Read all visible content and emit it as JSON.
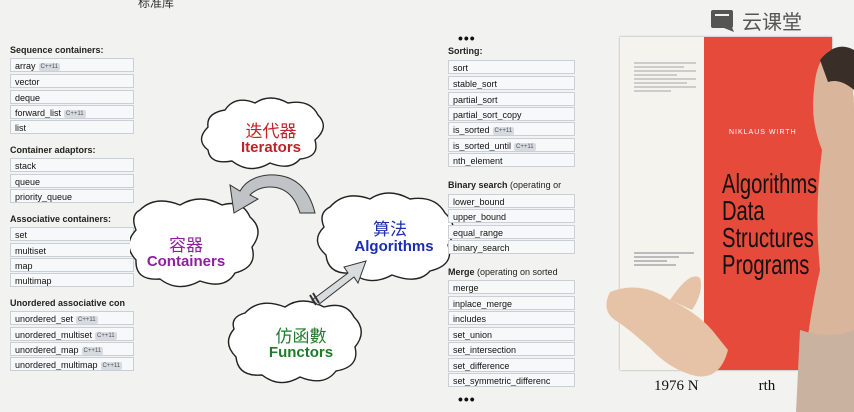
{
  "top_fragment": "标准库",
  "logo": {
    "text": "云课堂",
    "icon": "logo-icon"
  },
  "left": {
    "groups": [
      {
        "title": "Sequence containers:",
        "items": [
          {
            "label": "array",
            "badge": "C++11"
          },
          {
            "label": "vector",
            "badge": ""
          },
          {
            "label": "deque",
            "badge": ""
          },
          {
            "label": "forward_list",
            "badge": "C++11"
          },
          {
            "label": "list",
            "badge": ""
          }
        ]
      },
      {
        "title": "Container adaptors:",
        "items": [
          {
            "label": "stack",
            "badge": ""
          },
          {
            "label": "queue",
            "badge": ""
          },
          {
            "label": "priority_queue",
            "badge": ""
          }
        ]
      },
      {
        "title": "Associative containers:",
        "items": [
          {
            "label": "set",
            "badge": ""
          },
          {
            "label": "multiset",
            "badge": ""
          },
          {
            "label": "map",
            "badge": ""
          },
          {
            "label": "multimap",
            "badge": ""
          }
        ]
      },
      {
        "title": "Unordered associative con",
        "items": [
          {
            "label": "unordered_set",
            "badge": "C++11"
          },
          {
            "label": "unordered_multiset",
            "badge": "C++11"
          },
          {
            "label": "unordered_map",
            "badge": "C++11"
          },
          {
            "label": "unordered_multimap",
            "badge": "C++11"
          }
        ]
      }
    ]
  },
  "right": {
    "ellipsis": "•••",
    "groups": [
      {
        "title": "Sorting:",
        "note": "",
        "items": [
          {
            "label": "sort",
            "badge": ""
          },
          {
            "label": "stable_sort",
            "badge": ""
          },
          {
            "label": "partial_sort",
            "badge": ""
          },
          {
            "label": "partial_sort_copy",
            "badge": ""
          },
          {
            "label": "is_sorted",
            "badge": "C++11"
          },
          {
            "label": "is_sorted_until",
            "badge": "C++11"
          },
          {
            "label": "nth_element",
            "badge": ""
          }
        ]
      },
      {
        "title": "Binary search",
        "note": " (operating or",
        "items": [
          {
            "label": "lower_bound",
            "badge": ""
          },
          {
            "label": "upper_bound",
            "badge": ""
          },
          {
            "label": "equal_range",
            "badge": ""
          },
          {
            "label": "binary_search",
            "badge": ""
          }
        ]
      },
      {
        "title": "Merge",
        "note": " (operating on sorted",
        "items": [
          {
            "label": "merge",
            "badge": ""
          },
          {
            "label": "inplace_merge",
            "badge": ""
          },
          {
            "label": "includes",
            "badge": ""
          },
          {
            "label": "set_union",
            "badge": ""
          },
          {
            "label": "set_intersection",
            "badge": ""
          },
          {
            "label": "set_difference",
            "badge": ""
          },
          {
            "label": "set_symmetric_differenc",
            "badge": ""
          }
        ]
      }
    ]
  },
  "diagram": {
    "iterators": {
      "cn": "迭代器",
      "en": "Iterators",
      "color": "#c0222a"
    },
    "containers": {
      "cn": "容器",
      "en": "Containers",
      "color": "#8e1fa0"
    },
    "algorithms": {
      "cn": "算法",
      "en": "Algorithms",
      "color": "#1b2db0"
    },
    "functors": {
      "cn": "仿函數",
      "en": "Functors",
      "color": "#1f7a2a"
    }
  },
  "book": {
    "author": "NIKLAUS WIRTH",
    "title_lines": [
      "Algorithms +",
      "Data",
      "Structures =",
      "Programs"
    ],
    "caption": "1976 N",
    "caption_tail": "rth"
  }
}
